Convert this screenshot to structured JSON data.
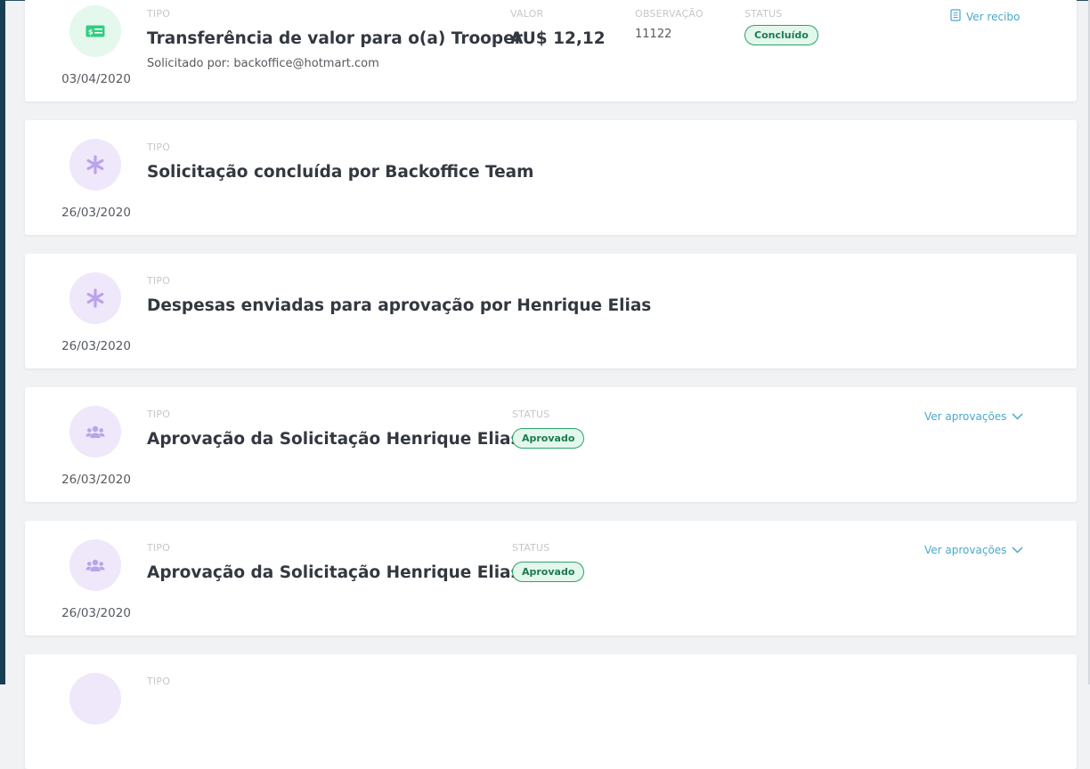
{
  "colors": {
    "status_badge_border": "#2ba36a",
    "status_badge_bg": "#e3f7ec",
    "status_badge_text": "#1b7b4f",
    "link": "#49a9c9",
    "icon_money_bg": "#e4f8ee",
    "icon_money_fg": "#2fcf7e",
    "icon_event_bg": "#eee8fa",
    "icon_event_fg": "#b9a3ec"
  },
  "timeline": [
    {
      "icon": "money-icon",
      "type_label": "TIPO",
      "title": "Transferência de valor para o(a) Trooper",
      "subtitle": "Solicitado por: backoffice@hotmart.com",
      "value_label": "VALOR",
      "value": "AU$ 12,12",
      "observation_label": "OBSERVAÇÃO",
      "observation": "11122",
      "status_label": "STATUS",
      "status": "Concluído",
      "action_label": "Ver recibo",
      "date": "03/04/2020"
    },
    {
      "icon": "asterisk-icon",
      "type_label": "TIPO",
      "title": "Solicitação concluída por Backoffice Team",
      "date": "26/03/2020"
    },
    {
      "icon": "asterisk-icon",
      "type_label": "TIPO",
      "title": "Despesas enviadas para aprovação por Henrique Elias",
      "date": "26/03/2020"
    },
    {
      "icon": "users-icon",
      "type_label": "TIPO",
      "title": "Aprovação da Solicitação Henrique Elias",
      "status_label": "STATUS",
      "status": "Aprovado",
      "action_label": "Ver aprovações",
      "date": "26/03/2020"
    },
    {
      "icon": "users-icon",
      "type_label": "TIPO",
      "title": "Aprovação da Solicitação Henrique Elias",
      "status_label": "STATUS",
      "status": "Aprovado",
      "action_label": "Ver aprovações",
      "date": "26/03/2020"
    },
    {
      "type_label": "TIPO"
    }
  ]
}
